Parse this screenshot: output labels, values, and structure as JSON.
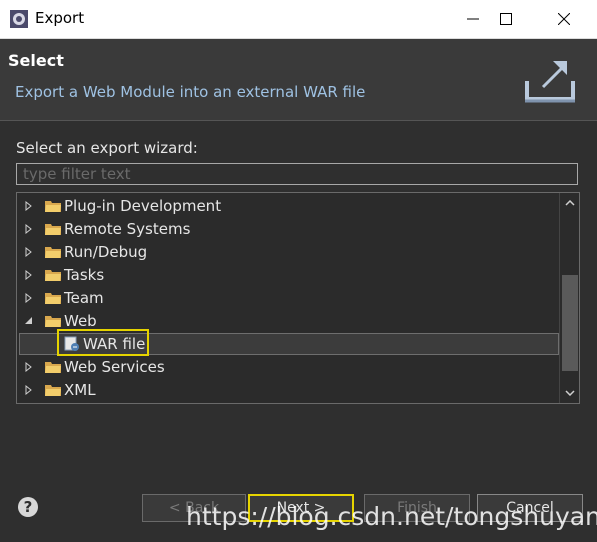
{
  "window": {
    "title": "Export",
    "minimize_icon": "minimize-icon",
    "maximize_icon": "maximize-icon",
    "close_icon": "close-icon"
  },
  "header": {
    "title": "Select",
    "description": "Export a Web Module into an external WAR file",
    "icon": "export-wizard-icon"
  },
  "wizard": {
    "prompt": "Select an export wizard:",
    "filter_placeholder": "type filter text",
    "filter_value": ""
  },
  "tree": {
    "items": [
      {
        "label": "Plug-in Development",
        "expanded": false
      },
      {
        "label": "Remote Systems",
        "expanded": false
      },
      {
        "label": "Run/Debug",
        "expanded": false
      },
      {
        "label": "Tasks",
        "expanded": false
      },
      {
        "label": "Team",
        "expanded": false
      },
      {
        "label": "Web",
        "expanded": true
      },
      {
        "label": "WAR file",
        "child": true,
        "selected": true
      },
      {
        "label": "Web Services",
        "expanded": false
      },
      {
        "label": "XML",
        "expanded": false
      }
    ]
  },
  "buttons": {
    "back": "< Back",
    "next": "Next >",
    "finish": "Finish",
    "cancel": "Cancel",
    "help": "?"
  },
  "watermark": "https://blog.csdn.net/tongshuyang",
  "colors": {
    "highlight": "#e6d400",
    "description_text": "#9fc2e3",
    "background": "#2f2f2f"
  }
}
